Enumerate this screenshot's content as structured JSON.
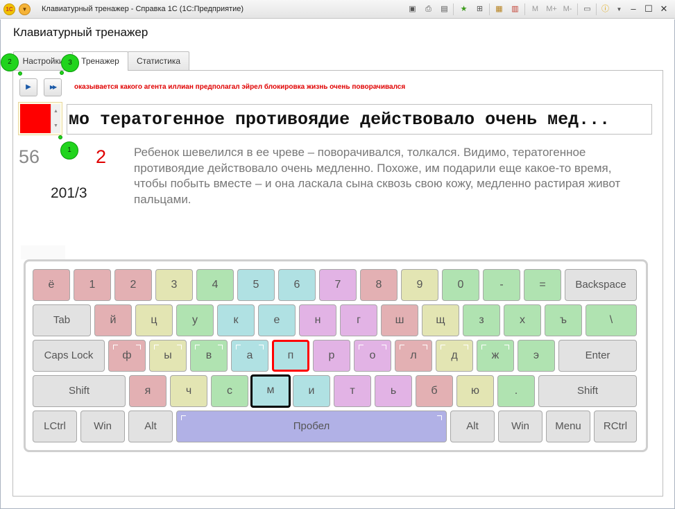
{
  "window": {
    "title": "Клавиатурный тренажер - Справка 1С  (1С:Предприятие)",
    "logo": "1С",
    "toolbar_icons": [
      "save-icon",
      "print-icon",
      "preview-icon",
      "favorites-icon",
      "bookmark-icon",
      "calculator-icon",
      "calendar-icon"
    ],
    "memory_buttons": [
      "M",
      "M+",
      "M-"
    ],
    "controls": [
      "info-icon",
      "minimize-icon",
      "restore-icon",
      "close-icon"
    ]
  },
  "form": {
    "title": "Клавиатурный тренажер",
    "tabs": [
      {
        "label": "Настройки",
        "active": false
      },
      {
        "label": "Тренажер",
        "active": true
      },
      {
        "label": "Статистика",
        "active": false
      }
    ]
  },
  "trainer": {
    "play_label": "▶",
    "skip_label": "▶▶",
    "words": "оказывается какого агента иллиан предполагал эйрел блокировка жизнь очень поворачивался",
    "color_swatch": "#ff0000",
    "typing_line": "мо тератогенное противоядие действовало очень мед...",
    "speed": "56",
    "errors": "2",
    "progress": "201/3",
    "paragraph": "Ребенок шевелился в ее чреве – поворачивался, толкался. Видимо, тератогенное противоядие действовало очень медленно. Похоже, им подарили еще какое-то время, чтобы побыть вместе – и она ласкала сына сквозь свою кожу, медленно растирая живот пальцами."
  },
  "markers": [
    "1",
    "2",
    "3"
  ],
  "keyboard": {
    "row1": [
      "ё",
      "1",
      "2",
      "3",
      "4",
      "5",
      "6",
      "7",
      "8",
      "9",
      "0",
      "-",
      "=",
      "Backspace"
    ],
    "row2": [
      "Tab",
      "й",
      "ц",
      "у",
      "к",
      "е",
      "н",
      "г",
      "ш",
      "щ",
      "з",
      "х",
      "ъ",
      "\\"
    ],
    "row3": [
      "Caps Lock",
      "ф",
      "ы",
      "в",
      "а",
      "п",
      "р",
      "о",
      "л",
      "д",
      "ж",
      "э",
      "Enter"
    ],
    "row4": [
      "Shift",
      "я",
      "ч",
      "с",
      "м",
      "и",
      "т",
      "ь",
      "б",
      "ю",
      ".",
      "Shift"
    ],
    "row5": [
      "LCtrl",
      "Win",
      "Alt",
      "Пробел",
      "Alt",
      "Win",
      "Menu",
      "RCtrl"
    ],
    "next_key": "п",
    "pressed_key": "м",
    "colors": {
      "red": "#e3b0b3",
      "yellow": "#e3e5b3",
      "green": "#b0e3b1",
      "cyan": "#b0e1e3",
      "purple": "#e2b3e5",
      "gray": "#e2e2e2",
      "space": "#b1b1e6"
    }
  }
}
